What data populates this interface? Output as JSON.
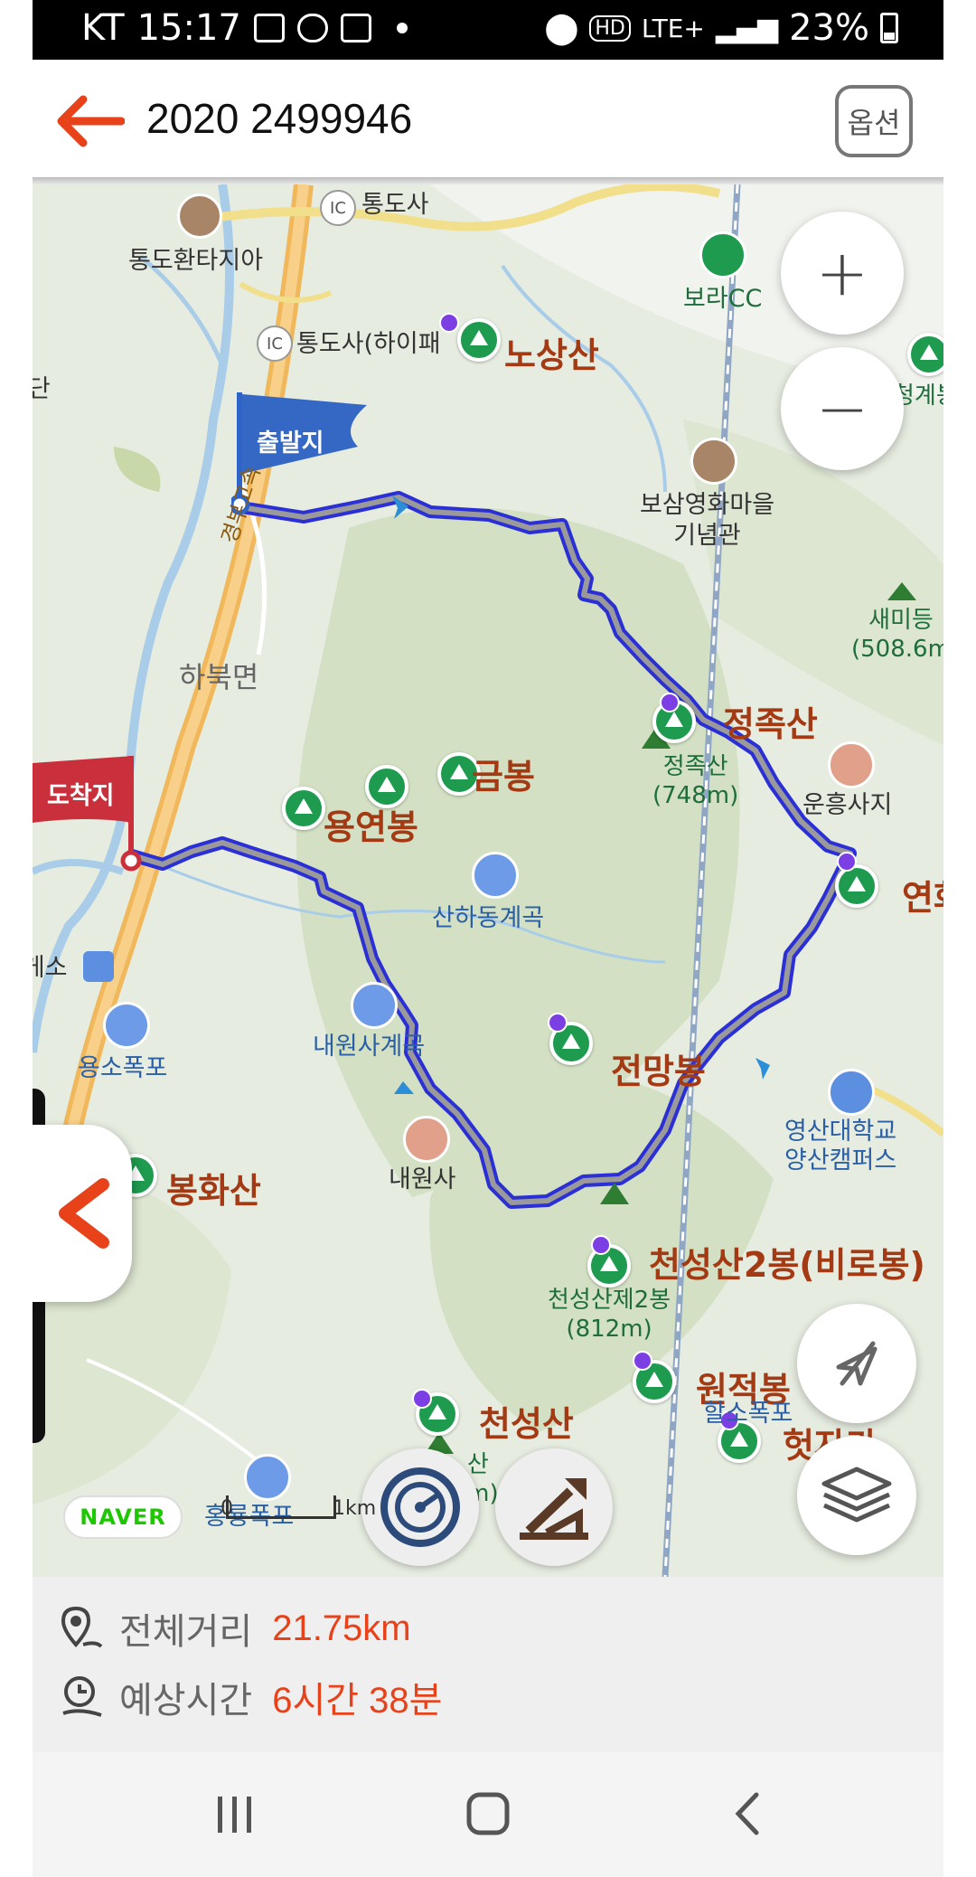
{
  "status_bar": {
    "carrier": "KT",
    "time": "15:17",
    "network": "LTE+",
    "battery": "23%",
    "hd_badge": "HD"
  },
  "app_bar": {
    "title": "2020 2499946",
    "options_label": "옵션",
    "back_icon": "back-arrow-icon"
  },
  "map": {
    "start_flag": "출발지",
    "end_flag": "도착지",
    "zoom_in": "+",
    "zoom_out": "−",
    "labels": {
      "tongdosa_ic": "통도사",
      "tongdo_fantasia": "통도환타지아",
      "tongdosa_hipass": "통도사(하이패",
      "bora_cc": "보라CC",
      "nosangsan": "노상산",
      "cheonggye": "청계봉",
      "idan": "이단",
      "bosam": "보삼영화마을\n기념관",
      "saemideung": "새미등\n(508.6m",
      "habuk": "하북면",
      "jeongjoksan": "정족산",
      "jeongjoksan_small": "정족산\n(748m)",
      "geumbong": "금봉",
      "yongyeonbong": "용연봉",
      "unheungsaji": "운흥사지",
      "yeonhwa": "연화",
      "sanha": "산하동계곡",
      "yuso": "휴게소",
      "yongso": "용소폭포",
      "naewon_valley": "내원사계곡",
      "jeonmangbong": "전망봉",
      "yeongsan": "영산대학교\n양산캠퍼스",
      "bonghwasan": "봉화산",
      "naewonsa": "내원사",
      "cheonseong2": "천성산2봉(비로봉)",
      "cheonseong2_small": "천성산제2봉\n(812m)",
      "wonjeokbong": "원적봉",
      "hongnyong": "홍룡폭포",
      "halso": "할소폭포",
      "cheonseongsan": "천성산",
      "heotjaga": "헛자가",
      "highway": "경부고속",
      "cheonseong_small": "산\n(m)"
    },
    "naver_logo": "NAVER",
    "scale_zero": "0",
    "scale_unit": "1km"
  },
  "summary": {
    "distance_label": "전체거리",
    "distance_value": "21.75km",
    "time_label": "예상시간",
    "time_value": "6시간 38분"
  },
  "colors": {
    "accent": "#e8421b",
    "route": "#2b2fd6",
    "start_flag": "#2e64c8",
    "end_flag": "#c9303c",
    "peak_green": "#1e9b4f"
  }
}
